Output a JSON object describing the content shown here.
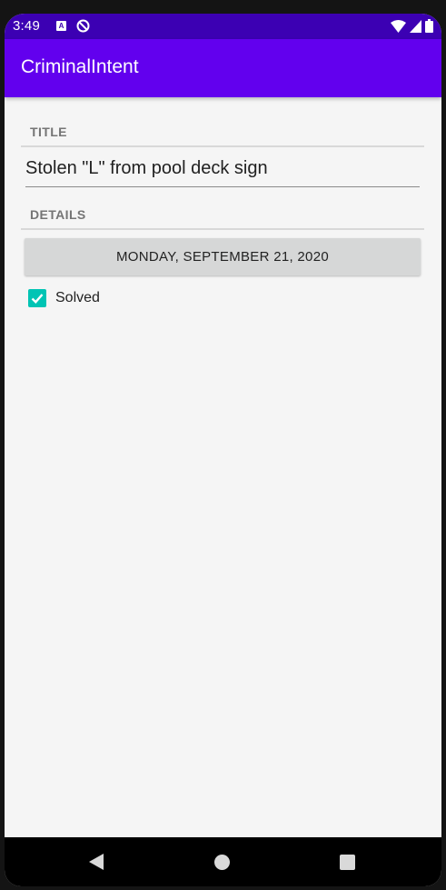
{
  "status_bar": {
    "time": "3:49",
    "notification_letter": "A",
    "icons": [
      "a-notification-icon",
      "no-disturb-icon",
      "wifi-icon",
      "signal-icon",
      "battery-icon"
    ]
  },
  "app_bar": {
    "title": "CriminalIntent"
  },
  "crime": {
    "title_header": "TITLE",
    "title_value": "Stolen \"L\" from pool deck sign",
    "details_header": "DETAILS",
    "date_label": "MONDAY, SEPTEMBER 21, 2020",
    "solved_label": "Solved",
    "solved_checked": true
  },
  "nav_bar": {
    "icons": [
      "back-icon",
      "home-icon",
      "recents-icon"
    ]
  },
  "colors": {
    "status_bar": "#3c00b3",
    "app_bar": "#6200ee",
    "checkbox_accent": "#00c4b4",
    "background": "#f5f5f5"
  }
}
